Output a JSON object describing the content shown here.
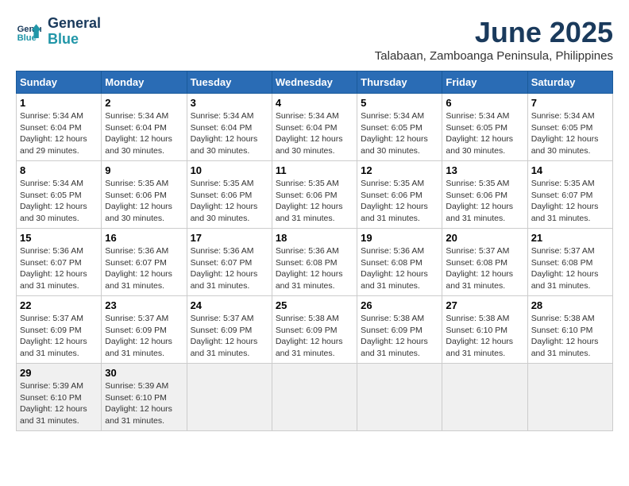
{
  "logo": {
    "line1": "General",
    "line2": "Blue"
  },
  "title": {
    "month": "June 2025",
    "location": "Talabaan, Zamboanga Peninsula, Philippines"
  },
  "weekdays": [
    "Sunday",
    "Monday",
    "Tuesday",
    "Wednesday",
    "Thursday",
    "Friday",
    "Saturday"
  ],
  "weeks": [
    [
      {
        "day": "1",
        "sunrise": "5:34 AM",
        "sunset": "6:04 PM",
        "daylight": "12 hours and 29 minutes."
      },
      {
        "day": "2",
        "sunrise": "5:34 AM",
        "sunset": "6:04 PM",
        "daylight": "12 hours and 30 minutes."
      },
      {
        "day": "3",
        "sunrise": "5:34 AM",
        "sunset": "6:04 PM",
        "daylight": "12 hours and 30 minutes."
      },
      {
        "day": "4",
        "sunrise": "5:34 AM",
        "sunset": "6:04 PM",
        "daylight": "12 hours and 30 minutes."
      },
      {
        "day": "5",
        "sunrise": "5:34 AM",
        "sunset": "6:05 PM",
        "daylight": "12 hours and 30 minutes."
      },
      {
        "day": "6",
        "sunrise": "5:34 AM",
        "sunset": "6:05 PM",
        "daylight": "12 hours and 30 minutes."
      },
      {
        "day": "7",
        "sunrise": "5:34 AM",
        "sunset": "6:05 PM",
        "daylight": "12 hours and 30 minutes."
      }
    ],
    [
      {
        "day": "8",
        "sunrise": "5:34 AM",
        "sunset": "6:05 PM",
        "daylight": "12 hours and 30 minutes."
      },
      {
        "day": "9",
        "sunrise": "5:35 AM",
        "sunset": "6:06 PM",
        "daylight": "12 hours and 30 minutes."
      },
      {
        "day": "10",
        "sunrise": "5:35 AM",
        "sunset": "6:06 PM",
        "daylight": "12 hours and 30 minutes."
      },
      {
        "day": "11",
        "sunrise": "5:35 AM",
        "sunset": "6:06 PM",
        "daylight": "12 hours and 31 minutes."
      },
      {
        "day": "12",
        "sunrise": "5:35 AM",
        "sunset": "6:06 PM",
        "daylight": "12 hours and 31 minutes."
      },
      {
        "day": "13",
        "sunrise": "5:35 AM",
        "sunset": "6:06 PM",
        "daylight": "12 hours and 31 minutes."
      },
      {
        "day": "14",
        "sunrise": "5:35 AM",
        "sunset": "6:07 PM",
        "daylight": "12 hours and 31 minutes."
      }
    ],
    [
      {
        "day": "15",
        "sunrise": "5:36 AM",
        "sunset": "6:07 PM",
        "daylight": "12 hours and 31 minutes."
      },
      {
        "day": "16",
        "sunrise": "5:36 AM",
        "sunset": "6:07 PM",
        "daylight": "12 hours and 31 minutes."
      },
      {
        "day": "17",
        "sunrise": "5:36 AM",
        "sunset": "6:07 PM",
        "daylight": "12 hours and 31 minutes."
      },
      {
        "day": "18",
        "sunrise": "5:36 AM",
        "sunset": "6:08 PM",
        "daylight": "12 hours and 31 minutes."
      },
      {
        "day": "19",
        "sunrise": "5:36 AM",
        "sunset": "6:08 PM",
        "daylight": "12 hours and 31 minutes."
      },
      {
        "day": "20",
        "sunrise": "5:37 AM",
        "sunset": "6:08 PM",
        "daylight": "12 hours and 31 minutes."
      },
      {
        "day": "21",
        "sunrise": "5:37 AM",
        "sunset": "6:08 PM",
        "daylight": "12 hours and 31 minutes."
      }
    ],
    [
      {
        "day": "22",
        "sunrise": "5:37 AM",
        "sunset": "6:09 PM",
        "daylight": "12 hours and 31 minutes."
      },
      {
        "day": "23",
        "sunrise": "5:37 AM",
        "sunset": "6:09 PM",
        "daylight": "12 hours and 31 minutes."
      },
      {
        "day": "24",
        "sunrise": "5:37 AM",
        "sunset": "6:09 PM",
        "daylight": "12 hours and 31 minutes."
      },
      {
        "day": "25",
        "sunrise": "5:38 AM",
        "sunset": "6:09 PM",
        "daylight": "12 hours and 31 minutes."
      },
      {
        "day": "26",
        "sunrise": "5:38 AM",
        "sunset": "6:09 PM",
        "daylight": "12 hours and 31 minutes."
      },
      {
        "day": "27",
        "sunrise": "5:38 AM",
        "sunset": "6:10 PM",
        "daylight": "12 hours and 31 minutes."
      },
      {
        "day": "28",
        "sunrise": "5:38 AM",
        "sunset": "6:10 PM",
        "daylight": "12 hours and 31 minutes."
      }
    ],
    [
      {
        "day": "29",
        "sunrise": "5:39 AM",
        "sunset": "6:10 PM",
        "daylight": "12 hours and 31 minutes."
      },
      {
        "day": "30",
        "sunrise": "5:39 AM",
        "sunset": "6:10 PM",
        "daylight": "12 hours and 31 minutes."
      },
      null,
      null,
      null,
      null,
      null
    ]
  ]
}
